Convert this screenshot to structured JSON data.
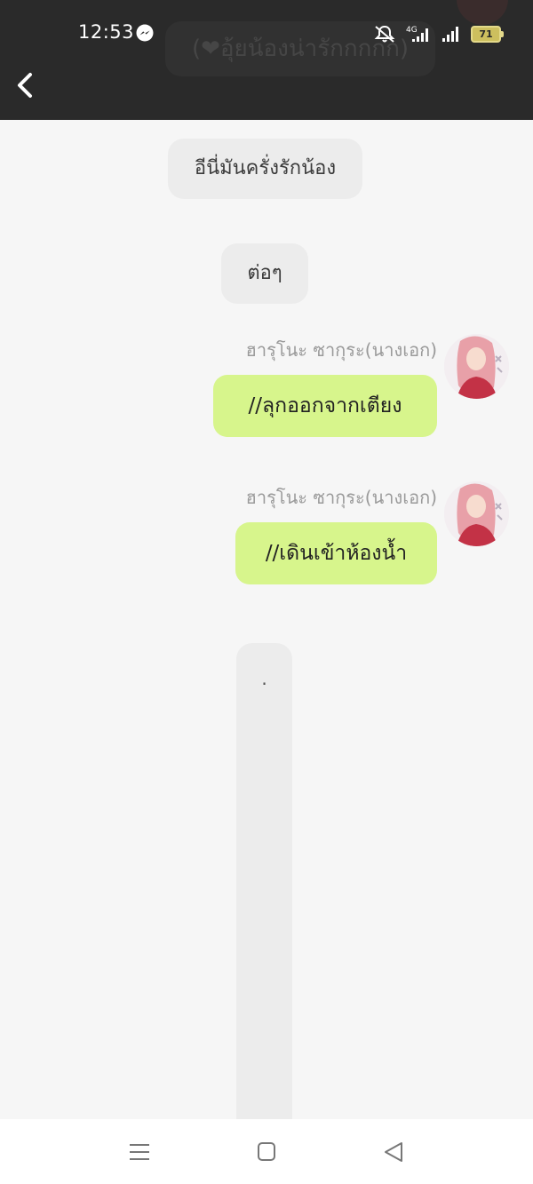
{
  "status_bar": {
    "time": "12:53",
    "battery_level": "71",
    "network_label": "4G",
    "icons": [
      "messenger-icon",
      "mute-icon",
      "signal-4g-icon",
      "signal-icon",
      "battery-icon"
    ]
  },
  "header": {
    "background_color": "#2a2a2a",
    "ghost_text": "(❤อุ้ยน้องน่ารักกกกก)"
  },
  "messages": [
    {
      "side": "system",
      "text": "อีนี่มันครั่งรักน้อง"
    },
    {
      "side": "system",
      "text": "ต่อๆ"
    },
    {
      "side": "right",
      "sender": "ฮารุโนะ ซากุระ(นางเอก)",
      "text": "//ลุกออกจากเตียง"
    },
    {
      "side": "right",
      "sender": "ฮารุโนะ ซากุระ(นางเอก)",
      "text": "//เดินเข้าห้องน้ำ"
    },
    {
      "side": "system",
      "text": "."
    }
  ],
  "colors": {
    "chat_background": "#f6f6f6",
    "right_bubble": "#d7f58c",
    "center_bubble": "#ececec",
    "sender_name": "#9a9a9a"
  },
  "navigation": {
    "icons": [
      "menu-icon",
      "home-square-icon",
      "back-triangle-icon"
    ]
  }
}
